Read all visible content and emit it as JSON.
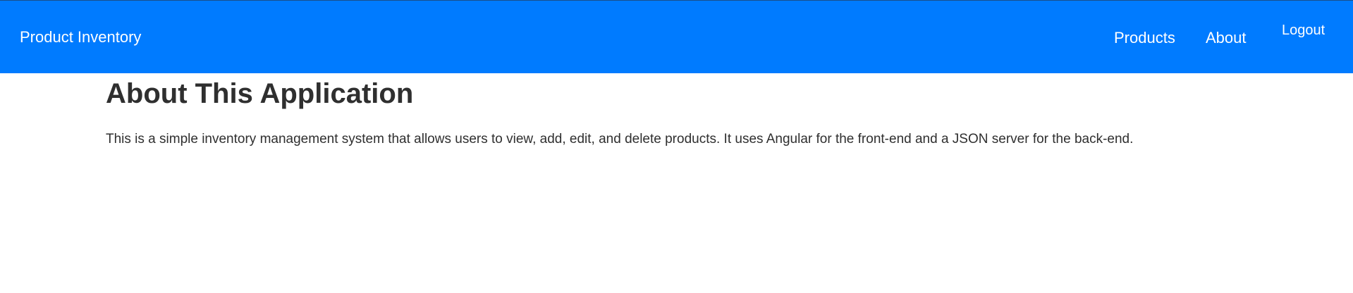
{
  "navbar": {
    "brand": "Product Inventory",
    "links": {
      "products": "Products",
      "about": "About",
      "logout": "Logout"
    },
    "background_color": "#007bff"
  },
  "main": {
    "title": "About This Application",
    "description": "This is a simple inventory management system that allows users to view, add, edit, and delete products. It uses Angular for the front-end and a JSON server for the back-end."
  }
}
